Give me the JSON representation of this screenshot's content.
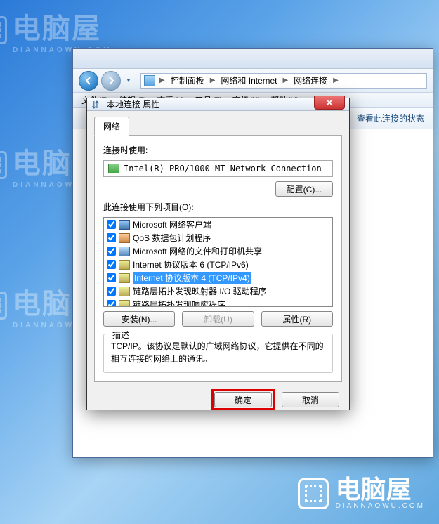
{
  "watermark": {
    "text": "电脑屋",
    "sub": "DIANNAOWU.COM"
  },
  "explorer": {
    "breadcrumb": {
      "items": [
        "控制面板",
        "网络和 Internet",
        "网络连接"
      ]
    },
    "menu": [
      "文件(F)",
      "编辑(E)",
      "查看(V)",
      "工具(T)",
      "高级(N)",
      "帮助(H)"
    ],
    "toolbar_status": "查看此连接的状态"
  },
  "dialog": {
    "title": "本地连接 属性",
    "tab": "网络",
    "connect_label": "连接时使用:",
    "adapter": "Intel(R) PRO/1000 MT Network Connection",
    "config_btn": "配置(C)...",
    "items_label": "此连接使用下列项目(O):",
    "items": [
      {
        "label": "Microsoft 网络客户端",
        "icon": "client",
        "checked": true
      },
      {
        "label": "QoS 数据包计划程序",
        "icon": "qos",
        "checked": true
      },
      {
        "label": "Microsoft 网络的文件和打印机共享",
        "icon": "share",
        "checked": true
      },
      {
        "label": "Internet 协议版本 6 (TCP/IPv6)",
        "icon": "proto",
        "checked": true
      },
      {
        "label": "Internet 协议版本 4 (TCP/IPv4)",
        "icon": "proto",
        "checked": true,
        "selected": true
      },
      {
        "label": "链路层拓扑发现映射器 I/O 驱动程序",
        "icon": "proto",
        "checked": true
      },
      {
        "label": "链路层拓扑发现响应程序",
        "icon": "proto",
        "checked": true
      }
    ],
    "install_btn": "安装(N)...",
    "uninstall_btn": "卸载(U)",
    "props_btn": "属性(R)",
    "desc_title": "描述",
    "desc_text": "TCP/IP。该协议是默认的广域网络协议，它提供在不同的相互连接的网络上的通讯。",
    "ok": "确定",
    "cancel": "取消"
  }
}
